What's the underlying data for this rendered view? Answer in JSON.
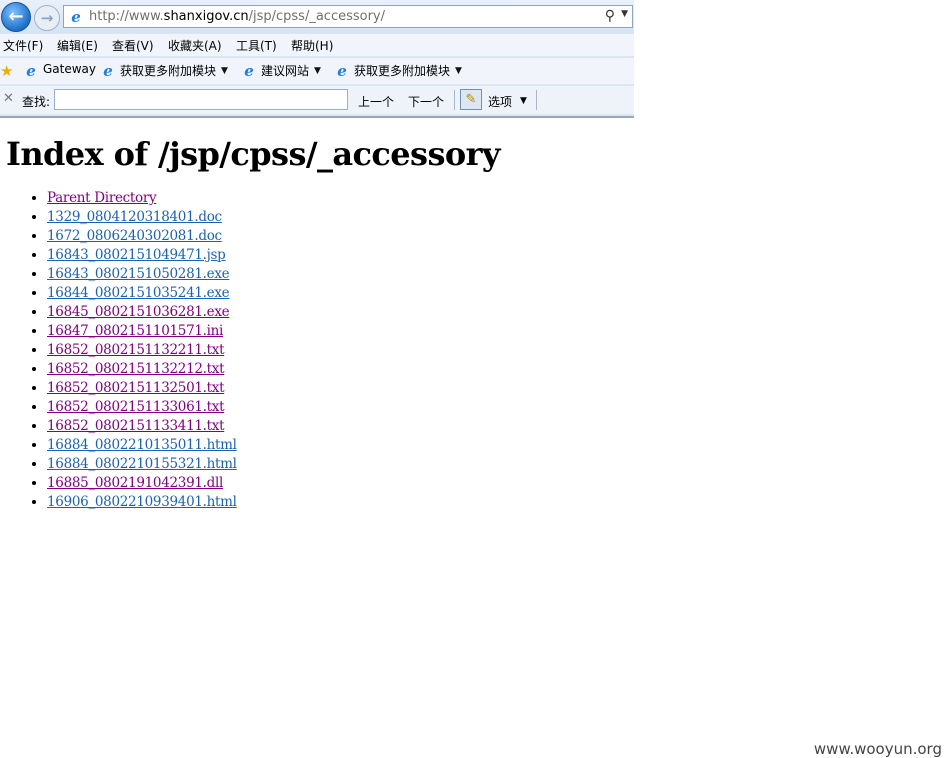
{
  "browser": {
    "address": {
      "prefix": "http://www.",
      "domain": "shanxigov.cn",
      "path": "/jsp/cpss/_accessory/"
    },
    "menu": [
      "文件(F)",
      "编辑(E)",
      "查看(V)",
      "收藏夹(A)",
      "工具(T)",
      "帮助(H)"
    ],
    "favorites": [
      "Gateway",
      "获取更多附加模块",
      "建议网站",
      "获取更多附加模块"
    ],
    "find": {
      "label": "查找:",
      "value": "",
      "prev": "上一个",
      "next": "下一个",
      "options": "选项"
    },
    "icons": {
      "back": "back-arrow-icon",
      "forward": "forward-arrow-icon",
      "ie": "ie-logo-icon",
      "search": "search-icon",
      "star": "favorites-star-icon",
      "close": "close-icon",
      "highlight": "highlight-pen-icon"
    }
  },
  "page": {
    "title": "Index of /jsp/cpss/_accessory",
    "items": [
      {
        "text": "Parent Directory",
        "visited": true
      },
      {
        "text": "1329_0804120318401.doc",
        "visited": false
      },
      {
        "text": "1672_0806240302081.doc",
        "visited": false
      },
      {
        "text": "16843_0802151049471.jsp",
        "visited": false
      },
      {
        "text": "16843_0802151050281.exe",
        "visited": false
      },
      {
        "text": "16844_0802151035241.exe",
        "visited": false
      },
      {
        "text": "16845_0802151036281.exe",
        "visited": true
      },
      {
        "text": "16847_0802151101571.ini",
        "visited": true
      },
      {
        "text": "16852_0802151132211.txt",
        "visited": true
      },
      {
        "text": "16852_0802151132212.txt",
        "visited": true
      },
      {
        "text": "16852_0802151132501.txt",
        "visited": true
      },
      {
        "text": "16852_0802151133061.txt",
        "visited": true
      },
      {
        "text": "16852_0802151133411.txt",
        "visited": true
      },
      {
        "text": "16884_0802210135011.html",
        "visited": false
      },
      {
        "text": "16884_0802210155321.html",
        "visited": false
      },
      {
        "text": "16885_0802191042391.dll",
        "visited": true
      },
      {
        "text": "16906_0802210939401.html",
        "visited": false
      }
    ]
  },
  "watermark": "www.wooyun.org"
}
